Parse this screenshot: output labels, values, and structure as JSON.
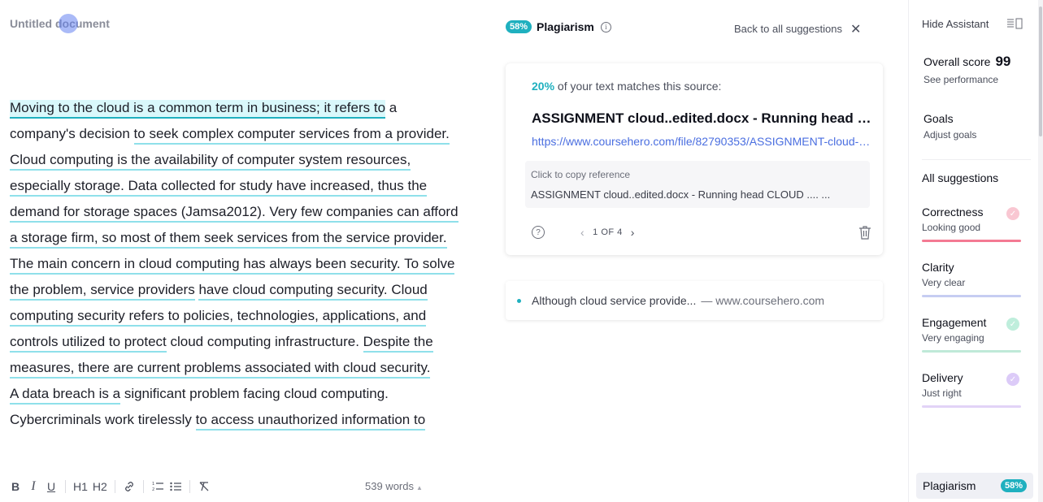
{
  "document": {
    "title": "Untitled document",
    "paragraphs": [
      [
        {
          "t": "Moving to the cloud is a common term in business; it refers to",
          "u": "active"
        },
        {
          "t": " a company's decision ",
          "u": ""
        },
        {
          "t": "to seek complex computer services from a provider. Cloud computing is the availability of computer system resources, especially storage. Data collected for study have increased, thus the demand for storage spaces (Jamsa2012). Very few companies can afford a storage firm, so most of them seek services from the service provider. The main concern in cloud computing has always been security. To solve the problem, service providers",
          "u": "ul"
        },
        {
          "t": " ",
          "u": ""
        },
        {
          "t": "have cloud computing security. Cloud computing security refers to policies, technologies, applications, and controls utilized to protect",
          "u": "ul"
        },
        {
          "t": " cloud computing infrastructure. ",
          "u": ""
        },
        {
          "t": "Despite the measures, there are current problems associated with cloud security.",
          "u": "ul"
        }
      ],
      [
        {
          "t": "A data breach is a",
          "u": "ul"
        },
        {
          "t": " significant problem facing cloud computing. Cybercriminals work tirelessly ",
          "u": ""
        },
        {
          "t": "to access unauthorized information to",
          "u": "ul"
        }
      ]
    ]
  },
  "toolbar": {
    "bold": "B",
    "italic": "I",
    "underline": "U",
    "h1": "H1",
    "h2": "H2",
    "word_count": "539 words"
  },
  "panel": {
    "score_badge": "58%",
    "title": "Plagiarism",
    "back_link": "Back to all suggestions",
    "card": {
      "match_pct": "20%",
      "match_text": " of your text matches this source:",
      "source_title": "ASSIGNMENT cloud..edited.docx - Running head CLOUD",
      "source_url": "https://www.coursehero.com/file/82790353/ASSIGNMENT-cloud-edited-docx/",
      "copy_label": "Click to copy reference",
      "copy_ref": "ASSIGNMENT cloud..edited.docx - Running head CLOUD .... ...",
      "pager": "1 OF 4"
    },
    "card2": {
      "text": "Although cloud service provide...",
      "site": "— www.coursehero.com"
    }
  },
  "sidebar": {
    "hide_assistant": "Hide Assistant",
    "overall_score_label": "Overall score",
    "overall_score": "99",
    "see_performance": "See performance",
    "goals_label": "Goals",
    "adjust_goals": "Adjust goals",
    "all_suggestions": "All suggestions",
    "categories": [
      {
        "name": "Correctness",
        "status": "Looking good",
        "color": "#f47a93",
        "check": "#f9c7d2"
      },
      {
        "name": "Clarity",
        "status": "Very clear",
        "color": "#c6cdf2",
        "check": ""
      },
      {
        "name": "Engagement",
        "status": "Very engaging",
        "color": "#bfe9d8",
        "check": "#bfeedc"
      },
      {
        "name": "Delivery",
        "status": "Just right",
        "color": "#e2d3f7",
        "check": "#dccbf8"
      }
    ],
    "plagiarism_tab": "Plagiarism",
    "plagiarism_badge": "58%"
  },
  "colors": {
    "accent": "#1fb0bf",
    "link": "#4a6ee0",
    "underline": "#8fe0ea"
  }
}
